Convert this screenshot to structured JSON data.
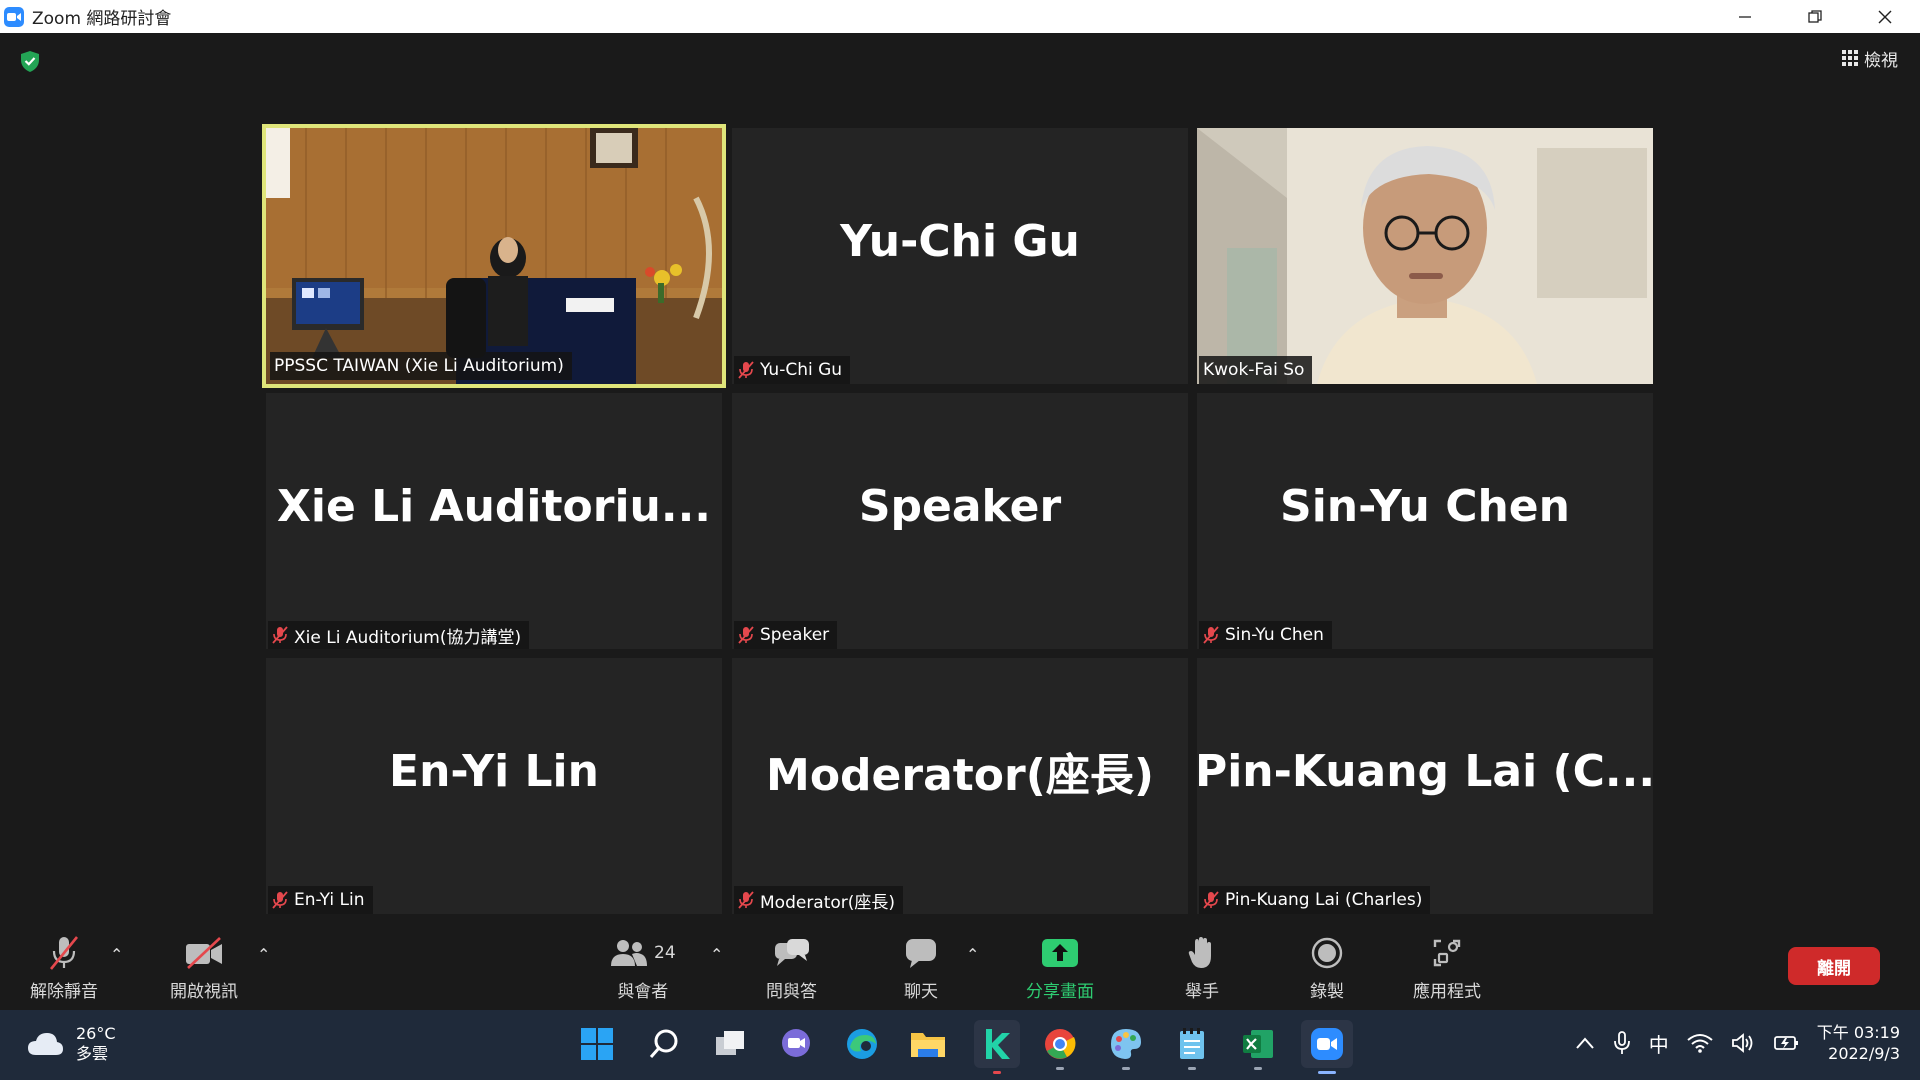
{
  "window": {
    "title": "Zoom 網路研討會"
  },
  "top": {
    "view_label": "檢視"
  },
  "participants": [
    {
      "display_name": "",
      "label": "PPSSC TAIWAN (Xie Li Auditorium)",
      "muted": false,
      "video": true,
      "active": true
    },
    {
      "display_name": "Yu-Chi Gu",
      "label": "Yu-Chi Gu",
      "muted": true
    },
    {
      "display_name": "",
      "label": "Kwok-Fai So",
      "muted": false,
      "video": true
    },
    {
      "display_name": "Xie  Li  Auditoriu...",
      "label": "Xie Li Auditorium(協力講堂)",
      "muted": true
    },
    {
      "display_name": "Speaker",
      "label": "Speaker",
      "muted": true
    },
    {
      "display_name": "Sin-Yu Chen",
      "label": "Sin-Yu Chen",
      "muted": true
    },
    {
      "display_name": "En-Yi Lin",
      "label": "En-Yi Lin",
      "muted": true
    },
    {
      "display_name": "Moderator(座長)",
      "label": "Moderator(座長)",
      "muted": true
    },
    {
      "display_name": "Pin-Kuang  Lai  (C...",
      "label": "Pin-Kuang Lai (Charles)",
      "muted": true
    }
  ],
  "toolbar": {
    "unmute": "解除靜音",
    "start_video": "開啟視訊",
    "participants_count": "24",
    "participants": "與會者",
    "qa": "問與答",
    "chat": "聊天",
    "share": "分享畫面",
    "raise_hand": "舉手",
    "record": "錄製",
    "apps": "應用程式",
    "leave": "離開",
    "share_color": "#2ecc71",
    "leave_color": "#cf2a2a"
  },
  "taskbar": {
    "temperature": "26°C",
    "weather": "多雲",
    "input_method": "中",
    "time": "下午 03:19",
    "date": "2022/9/3"
  }
}
